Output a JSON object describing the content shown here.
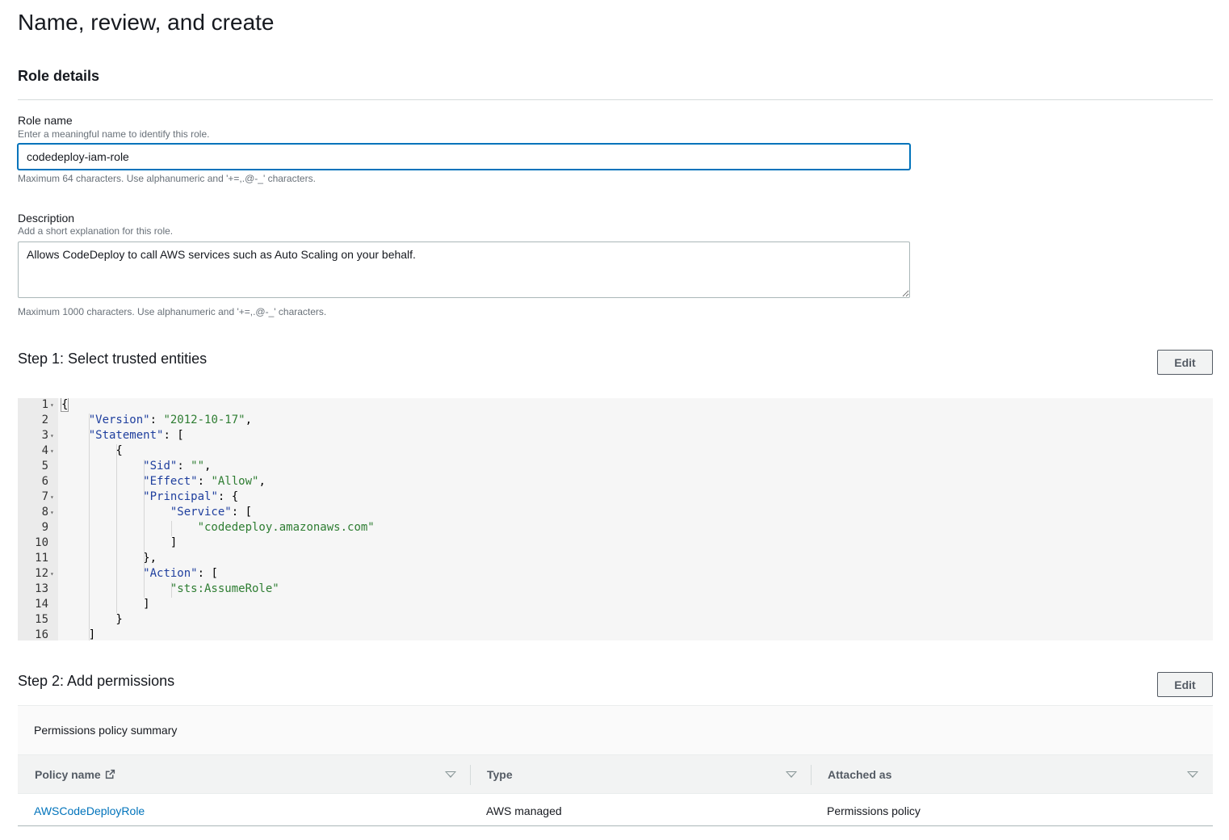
{
  "page": {
    "title": "Name, review, and create"
  },
  "role_details": {
    "section_title": "Role details",
    "role_name": {
      "label": "Role name",
      "description": "Enter a meaningful name to identify this role.",
      "value": "codedeploy-iam-role",
      "hint": "Maximum 64 characters. Use alphanumeric and '+=,.@-_' characters."
    },
    "description": {
      "label": "Description",
      "description": "Add a short explanation for this role.",
      "value": "Allows CodeDeploy to call AWS services such as Auto Scaling on your behalf.",
      "hint": "Maximum 1000 characters. Use alphanumeric and '+=,.@-_' characters."
    }
  },
  "step1": {
    "title": "Step 1: Select trusted entities",
    "edit_label": "Edit",
    "code_lines": [
      {
        "no": "1",
        "fold": true,
        "tokens": [
          {
            "t": "{",
            "c": "punct"
          }
        ]
      },
      {
        "no": "2",
        "fold": false,
        "tokens": [
          {
            "t": "    ",
            "c": "punct"
          },
          {
            "t": "\"Version\"",
            "c": "key"
          },
          {
            "t": ": ",
            "c": "punct"
          },
          {
            "t": "\"2012-10-17\"",
            "c": "str"
          },
          {
            "t": ",",
            "c": "punct"
          }
        ]
      },
      {
        "no": "3",
        "fold": true,
        "tokens": [
          {
            "t": "    ",
            "c": "punct"
          },
          {
            "t": "\"Statement\"",
            "c": "key"
          },
          {
            "t": ": [",
            "c": "punct"
          }
        ]
      },
      {
        "no": "4",
        "fold": true,
        "tokens": [
          {
            "t": "        {",
            "c": "punct"
          }
        ]
      },
      {
        "no": "5",
        "fold": false,
        "tokens": [
          {
            "t": "            ",
            "c": "punct"
          },
          {
            "t": "\"Sid\"",
            "c": "key"
          },
          {
            "t": ": ",
            "c": "punct"
          },
          {
            "t": "\"\"",
            "c": "str"
          },
          {
            "t": ",",
            "c": "punct"
          }
        ]
      },
      {
        "no": "6",
        "fold": false,
        "tokens": [
          {
            "t": "            ",
            "c": "punct"
          },
          {
            "t": "\"Effect\"",
            "c": "key"
          },
          {
            "t": ": ",
            "c": "punct"
          },
          {
            "t": "\"Allow\"",
            "c": "str"
          },
          {
            "t": ",",
            "c": "punct"
          }
        ]
      },
      {
        "no": "7",
        "fold": true,
        "tokens": [
          {
            "t": "            ",
            "c": "punct"
          },
          {
            "t": "\"Principal\"",
            "c": "key"
          },
          {
            "t": ": {",
            "c": "punct"
          }
        ]
      },
      {
        "no": "8",
        "fold": true,
        "tokens": [
          {
            "t": "                ",
            "c": "punct"
          },
          {
            "t": "\"Service\"",
            "c": "key"
          },
          {
            "t": ": [",
            "c": "punct"
          }
        ]
      },
      {
        "no": "9",
        "fold": false,
        "tokens": [
          {
            "t": "                    ",
            "c": "punct"
          },
          {
            "t": "\"codedeploy.amazonaws.com\"",
            "c": "str"
          }
        ]
      },
      {
        "no": "10",
        "fold": false,
        "tokens": [
          {
            "t": "                ]",
            "c": "punct"
          }
        ]
      },
      {
        "no": "11",
        "fold": false,
        "tokens": [
          {
            "t": "            },",
            "c": "punct"
          }
        ]
      },
      {
        "no": "12",
        "fold": true,
        "tokens": [
          {
            "t": "            ",
            "c": "punct"
          },
          {
            "t": "\"Action\"",
            "c": "key"
          },
          {
            "t": ": [",
            "c": "punct"
          }
        ]
      },
      {
        "no": "13",
        "fold": false,
        "tokens": [
          {
            "t": "                ",
            "c": "punct"
          },
          {
            "t": "\"sts:AssumeRole\"",
            "c": "str"
          }
        ]
      },
      {
        "no": "14",
        "fold": false,
        "tokens": [
          {
            "t": "            ]",
            "c": "punct"
          }
        ]
      },
      {
        "no": "15",
        "fold": false,
        "tokens": [
          {
            "t": "        }",
            "c": "punct"
          }
        ]
      },
      {
        "no": "16",
        "fold": false,
        "tokens": [
          {
            "t": "    ]",
            "c": "punct"
          }
        ]
      }
    ]
  },
  "step2": {
    "title": "Step 2: Add permissions",
    "edit_label": "Edit",
    "summary_title": "Permissions policy summary",
    "columns": [
      "Policy name",
      "Type",
      "Attached as"
    ],
    "rows": [
      {
        "policy_name": "AWSCodeDeployRole",
        "type": "AWS managed",
        "attached_as": "Permissions policy"
      }
    ]
  }
}
